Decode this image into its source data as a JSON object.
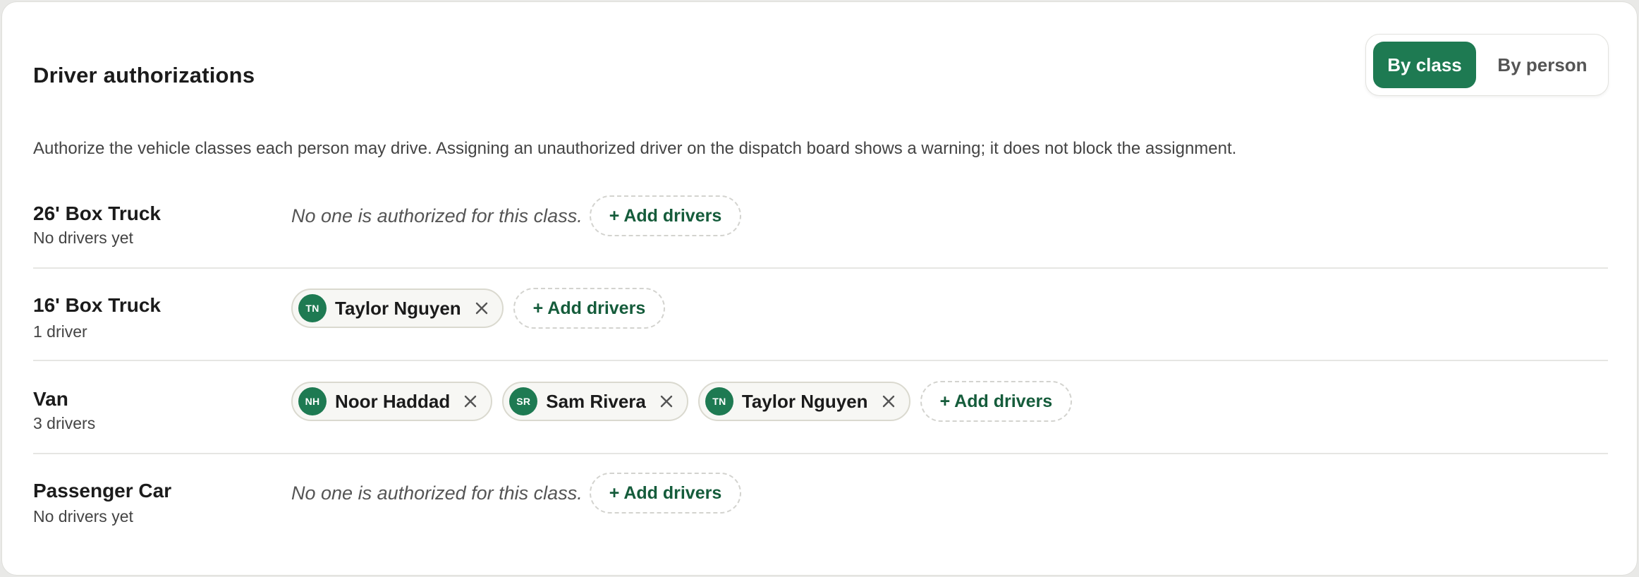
{
  "header": {
    "title": "Driver authorizations",
    "view_toggle": {
      "by_class": "By class",
      "by_person": "By person",
      "selected": "By class"
    }
  },
  "description": "Authorize the vehicle classes each person may drive. Assigning an unauthorized driver on the dispatch board shows a warning; it does not block the assignment.",
  "add_drivers_label": "+ Add drivers",
  "empty_note": "No one is authorized for this class.",
  "rows": [
    {
      "class_name": "26' Box Truck",
      "count_text": "No drivers yet",
      "drivers": []
    },
    {
      "class_name": "16' Box Truck",
      "count_text": "1 driver",
      "drivers": [
        {
          "initials": "TN",
          "name": "Taylor Nguyen"
        }
      ]
    },
    {
      "class_name": "Van",
      "count_text": "3 drivers",
      "drivers": [
        {
          "initials": "NH",
          "name": "Noor Haddad"
        },
        {
          "initials": "SR",
          "name": "Sam Rivera"
        },
        {
          "initials": "TN",
          "name": "Taylor Nguyen"
        }
      ]
    },
    {
      "class_name": "Passenger Car",
      "count_text": "No drivers yet",
      "drivers": []
    }
  ],
  "icons": {
    "remove": "close-icon"
  },
  "colors": {
    "accent": "#1e7a52",
    "accent_text": "#155c3b"
  }
}
